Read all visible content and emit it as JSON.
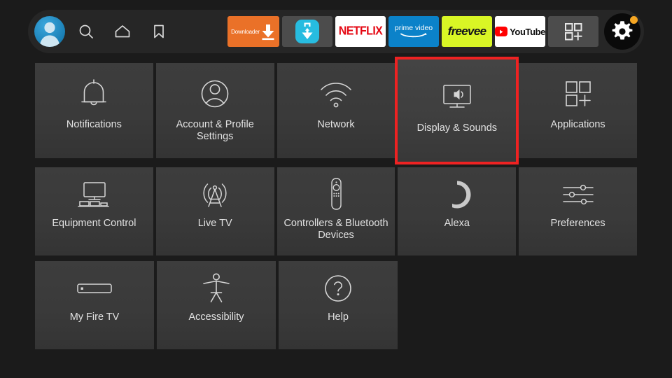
{
  "navbar": {
    "avatar_label": "profile-avatar",
    "icons": [
      {
        "name": "search-icon",
        "label": "Search"
      },
      {
        "name": "home-icon",
        "label": "Home"
      },
      {
        "name": "bookmark-icon",
        "label": "Watchlist"
      }
    ],
    "apps": [
      {
        "name": "downloader",
        "label": "Downloader",
        "color": "#ea7128"
      },
      {
        "name": "app-store",
        "label": "App Store",
        "color": "#27bce0"
      },
      {
        "name": "netflix",
        "label": "NETFLIX",
        "color": "#e50914"
      },
      {
        "name": "prime-video",
        "label": "prime video",
        "color": "#0b82c9"
      },
      {
        "name": "freevee",
        "label": "freevee",
        "color": "#d9f625"
      },
      {
        "name": "youtube",
        "label": "YouTube",
        "color": "#ff0000"
      },
      {
        "name": "apps-grid",
        "label": "Apps",
        "color": "#4c4c4c"
      }
    ],
    "settings": {
      "label": "Settings",
      "icon": "gear-icon",
      "selected": true,
      "notification_dot": true,
      "notification_color": "#f5a623"
    }
  },
  "settings_grid": {
    "highlight_color": "#ee2222",
    "selected_tile": "Display & Sounds",
    "rows": [
      [
        {
          "label": "Notifications",
          "icon": "bell-icon"
        },
        {
          "label": "Account & Profile Settings",
          "icon": "person-circle-icon"
        },
        {
          "label": "Network",
          "icon": "wifi-icon"
        },
        {
          "label": "Display & Sounds",
          "icon": "tv-speaker-icon",
          "selected": true
        },
        {
          "label": "Applications",
          "icon": "apps-grid-plus-icon"
        }
      ],
      [
        {
          "label": "Equipment Control",
          "icon": "tv-equipment-icon"
        },
        {
          "label": "Live TV",
          "icon": "broadcast-tower-icon"
        },
        {
          "label": "Controllers & Bluetooth Devices",
          "icon": "remote-control-icon"
        },
        {
          "label": "Alexa",
          "icon": "alexa-ring-icon"
        },
        {
          "label": "Preferences",
          "icon": "sliders-icon"
        }
      ],
      [
        {
          "label": "My Fire TV",
          "icon": "fire-tv-stick-icon"
        },
        {
          "label": "Accessibility",
          "icon": "accessibility-person-icon"
        },
        {
          "label": "Help",
          "icon": "question-circle-icon"
        }
      ]
    ]
  }
}
